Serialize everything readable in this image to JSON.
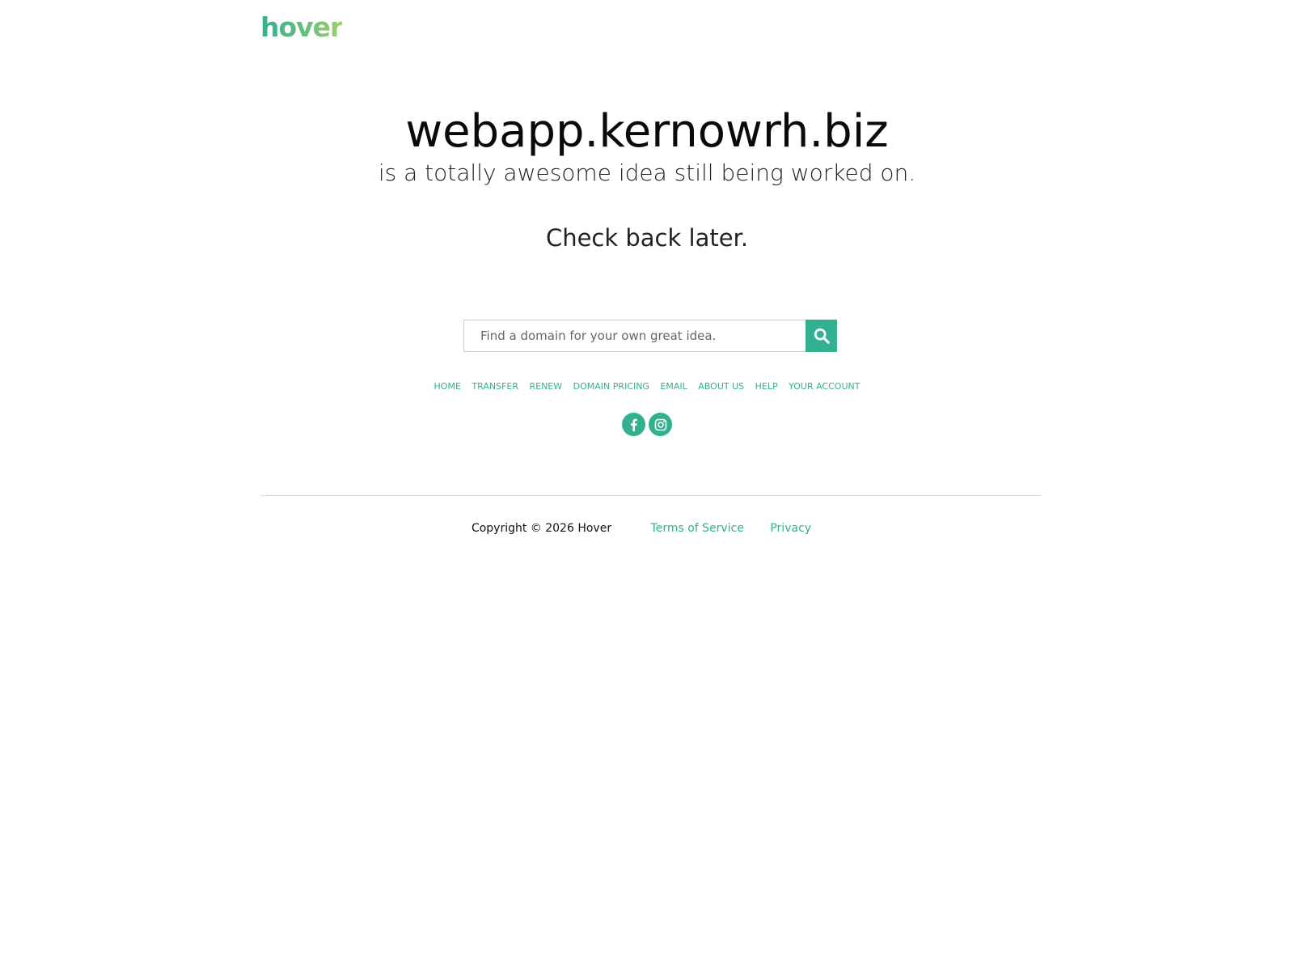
{
  "header": {
    "logo_text": "hover"
  },
  "hero": {
    "domain": "webapp.kernowrh.biz",
    "tagline": "is a totally awesome idea still being worked on.",
    "check_back": "Check back later."
  },
  "search": {
    "placeholder": "Find a domain for your own great idea.",
    "value": "",
    "button_icon": "search-icon"
  },
  "nav": {
    "items": [
      {
        "label": "HOME"
      },
      {
        "label": "TRANSFER"
      },
      {
        "label": "RENEW"
      },
      {
        "label": "DOMAIN PRICING"
      },
      {
        "label": "EMAIL"
      },
      {
        "label": "ABOUT US"
      },
      {
        "label": "HELP"
      },
      {
        "label": "YOUR ACCOUNT"
      }
    ]
  },
  "social": {
    "icons": [
      "facebook-icon",
      "instagram-icon"
    ]
  },
  "footer": {
    "copyright": "Copyright © 2026 Hover",
    "terms_label": "Terms of Service",
    "privacy_label": "Privacy"
  },
  "colors": {
    "accent": "#33b08f",
    "logo_gradient_end": "#9fd069",
    "text": "#111111",
    "divider": "#d9d9d9"
  }
}
